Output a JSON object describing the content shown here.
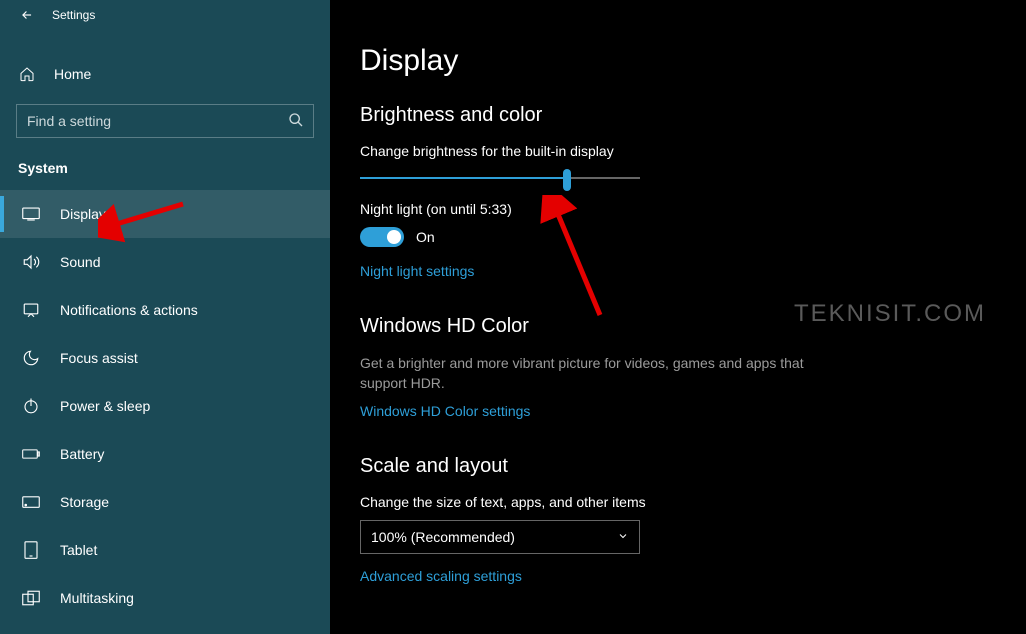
{
  "titlebar": {
    "title": "Settings"
  },
  "sidebar": {
    "home_label": "Home",
    "search_placeholder": "Find a setting",
    "category_label": "System",
    "items": [
      {
        "label": "Display"
      },
      {
        "label": "Sound"
      },
      {
        "label": "Notifications & actions"
      },
      {
        "label": "Focus assist"
      },
      {
        "label": "Power & sleep"
      },
      {
        "label": "Battery"
      },
      {
        "label": "Storage"
      },
      {
        "label": "Tablet"
      },
      {
        "label": "Multitasking"
      }
    ]
  },
  "content": {
    "page_title": "Display",
    "brightness": {
      "heading": "Brightness and color",
      "slider_label": "Change brightness for the built-in display",
      "slider_percent": 74,
      "night_light_label": "Night light (on until 5:33)",
      "toggle_state": "On",
      "night_light_link": "Night light settings"
    },
    "hdcolor": {
      "heading": "Windows HD Color",
      "desc": "Get a brighter and more vibrant picture for videos, games and apps that support HDR.",
      "link": "Windows HD Color settings"
    },
    "scale": {
      "heading": "Scale and layout",
      "select_label": "Change the size of text, apps, and other items",
      "select_value": "100% (Recommended)",
      "advanced_link": "Advanced scaling settings"
    }
  },
  "watermark": "TEKNISIT.COM"
}
